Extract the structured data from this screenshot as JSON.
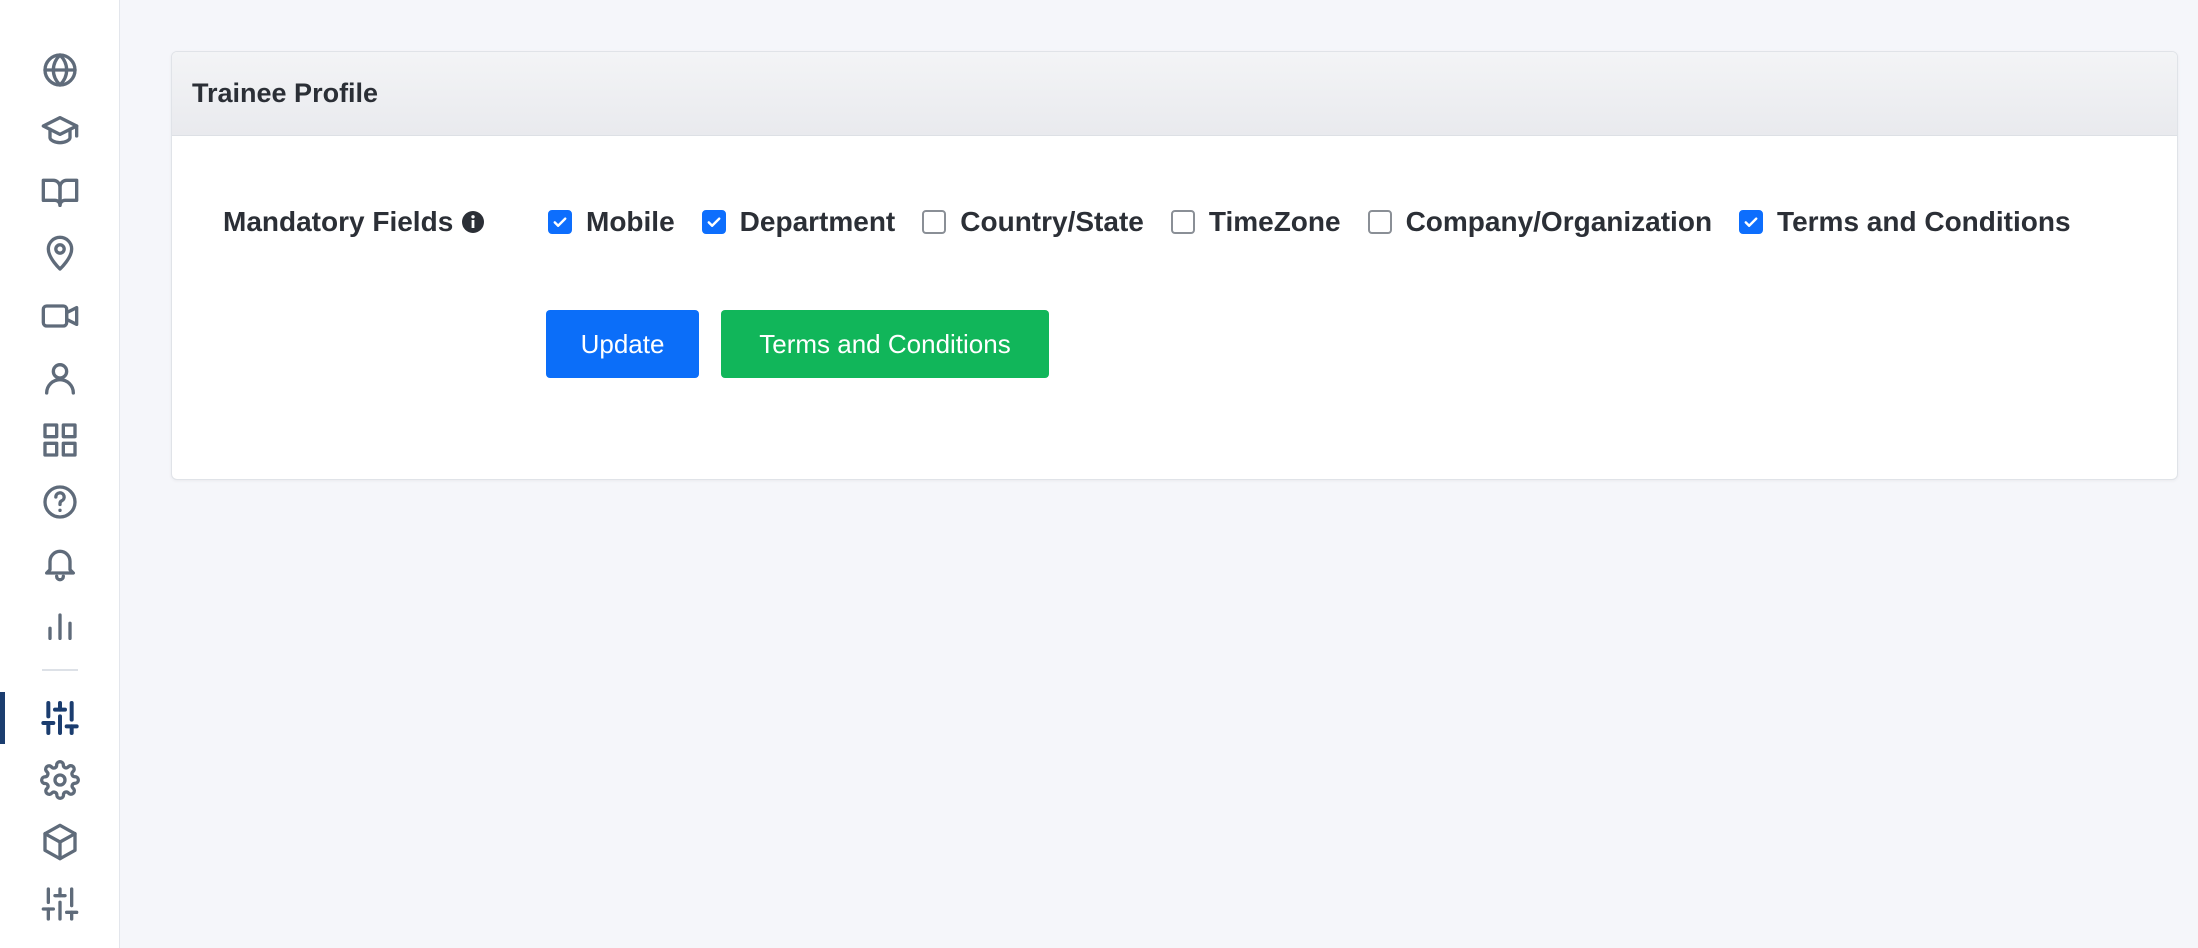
{
  "colors": {
    "accent": "#0b6ef9",
    "success": "#11b65a",
    "sidebar_active": "#1b3d6f",
    "icon": "#5f6b7a"
  },
  "sidebar": {
    "items": [
      {
        "icon": "globe-icon",
        "active": false
      },
      {
        "icon": "graduation-cap-icon",
        "active": false
      },
      {
        "icon": "book-open-icon",
        "active": false
      },
      {
        "icon": "map-pin-icon",
        "active": false
      },
      {
        "icon": "video-icon",
        "active": false
      },
      {
        "icon": "user-icon",
        "active": false
      },
      {
        "icon": "grid-icon",
        "active": false
      },
      {
        "icon": "help-circle-icon",
        "active": false
      },
      {
        "icon": "bell-icon",
        "active": false
      },
      {
        "icon": "bar-chart-icon",
        "active": false
      },
      {
        "icon": "sliders-icon",
        "active": true
      },
      {
        "icon": "gear-icon",
        "active": false
      },
      {
        "icon": "package-icon",
        "active": false
      },
      {
        "icon": "sliders-icon",
        "active": false
      }
    ]
  },
  "card": {
    "title": "Trainee Profile",
    "mandatory_label": "Mandatory Fields",
    "info_icon": "info-circle-icon",
    "fields": [
      {
        "label": "Mobile",
        "checked": true
      },
      {
        "label": "Department",
        "checked": true
      },
      {
        "label": "Country/State",
        "checked": false
      },
      {
        "label": "TimeZone",
        "checked": false
      },
      {
        "label": "Company/Organization",
        "checked": false
      },
      {
        "label": "Terms and Conditions",
        "checked": true
      }
    ],
    "update_button": "Update",
    "terms_button": "Terms and Conditions"
  }
}
